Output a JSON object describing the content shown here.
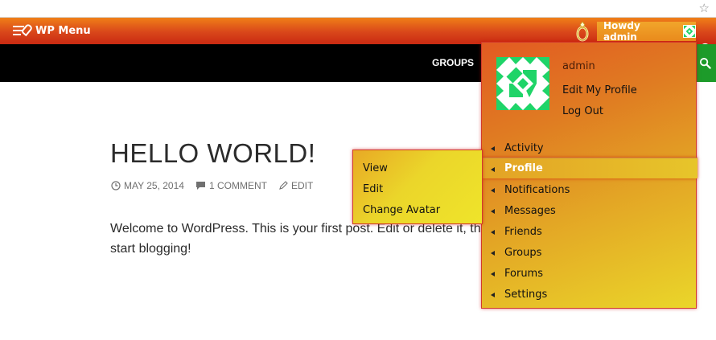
{
  "admin_bar": {
    "menu_label": "WP Menu",
    "howdy_label": "Howdy admin"
  },
  "site_nav": {
    "groups_label": "GROUPS"
  },
  "post": {
    "title": "HELLO WORLD!",
    "date": "MAY 25, 2014",
    "comments": "1 COMMENT",
    "edit": "EDIT",
    "content": "Welcome to WordPress. This is your first post. Edit or delete it, then start blogging!"
  },
  "account_menu": {
    "username": "admin",
    "edit_profile": "Edit My Profile",
    "log_out": "Log Out",
    "items": [
      {
        "label": "Activity"
      },
      {
        "label": "Profile"
      },
      {
        "label": "Notifications"
      },
      {
        "label": "Messages"
      },
      {
        "label": "Friends"
      },
      {
        "label": "Groups"
      },
      {
        "label": "Forums"
      },
      {
        "label": "Settings"
      }
    ],
    "active_item": "Profile"
  },
  "profile_submenu": {
    "items": [
      {
        "label": "View"
      },
      {
        "label": "Edit"
      },
      {
        "label": "Change Avatar"
      }
    ]
  },
  "colors": {
    "admin_bar_top": "#f07f18",
    "admin_bar_bottom": "#c92a12",
    "avatar_green": "#1fd468",
    "search_green": "#1d9b2a"
  },
  "icons": [
    "star-icon",
    "wp-menu-icon",
    "ring-icon",
    "search-icon",
    "clock-icon",
    "comment-icon",
    "pencil-icon"
  ]
}
